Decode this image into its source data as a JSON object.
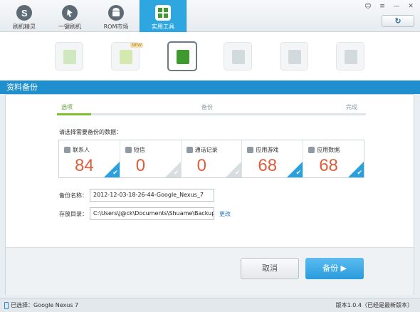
{
  "nav": {
    "tabs": [
      {
        "label": "刷机精灵",
        "icon": "logo-s-icon"
      },
      {
        "label": "一键刷机",
        "icon": "cursor-icon"
      },
      {
        "label": "ROM市场",
        "icon": "android-icon"
      },
      {
        "label": "实用工具",
        "icon": "grid-icon",
        "active": true
      }
    ]
  },
  "window_controls": {
    "feedback": "☺",
    "menu": "≡",
    "minimize": "—",
    "close": "✕",
    "refresh": "↻"
  },
  "tools": {
    "new_badge": "NEW"
  },
  "section_title": "资料备份",
  "steps": {
    "step1": "选项",
    "step2": "备份",
    "step3": "完成",
    "progress_fraction": 0.11
  },
  "instruction": "请选择需要备份的数据：",
  "cards": [
    {
      "title": "联系人",
      "value": "84",
      "checked": true
    },
    {
      "title": "短信",
      "value": "0",
      "checked": false
    },
    {
      "title": "通话记录",
      "value": "0",
      "checked": false
    },
    {
      "title": "应用游戏",
      "value": "68",
      "checked": true
    },
    {
      "title": "应用数据",
      "value": "68",
      "checked": true
    }
  ],
  "form": {
    "name_label": "备份名称：",
    "name_value": "2012-12-03-18-26-44-Google_Nexus_7",
    "dir_label": "存放目录：",
    "dir_value": "C:\\Users\\J@ck\\Documents\\Shuame\\Backup",
    "change_link": "更改"
  },
  "buttons": {
    "cancel": "取消",
    "backup": "备份 ▶"
  },
  "status": {
    "selected": "已选择：Google Nexus 7",
    "version": "版本1.0.4（已经是最新版本）"
  },
  "colors": {
    "accent": "#2ea7e0",
    "value_red": "#e05d3b",
    "progress_green": "#7fc032"
  }
}
